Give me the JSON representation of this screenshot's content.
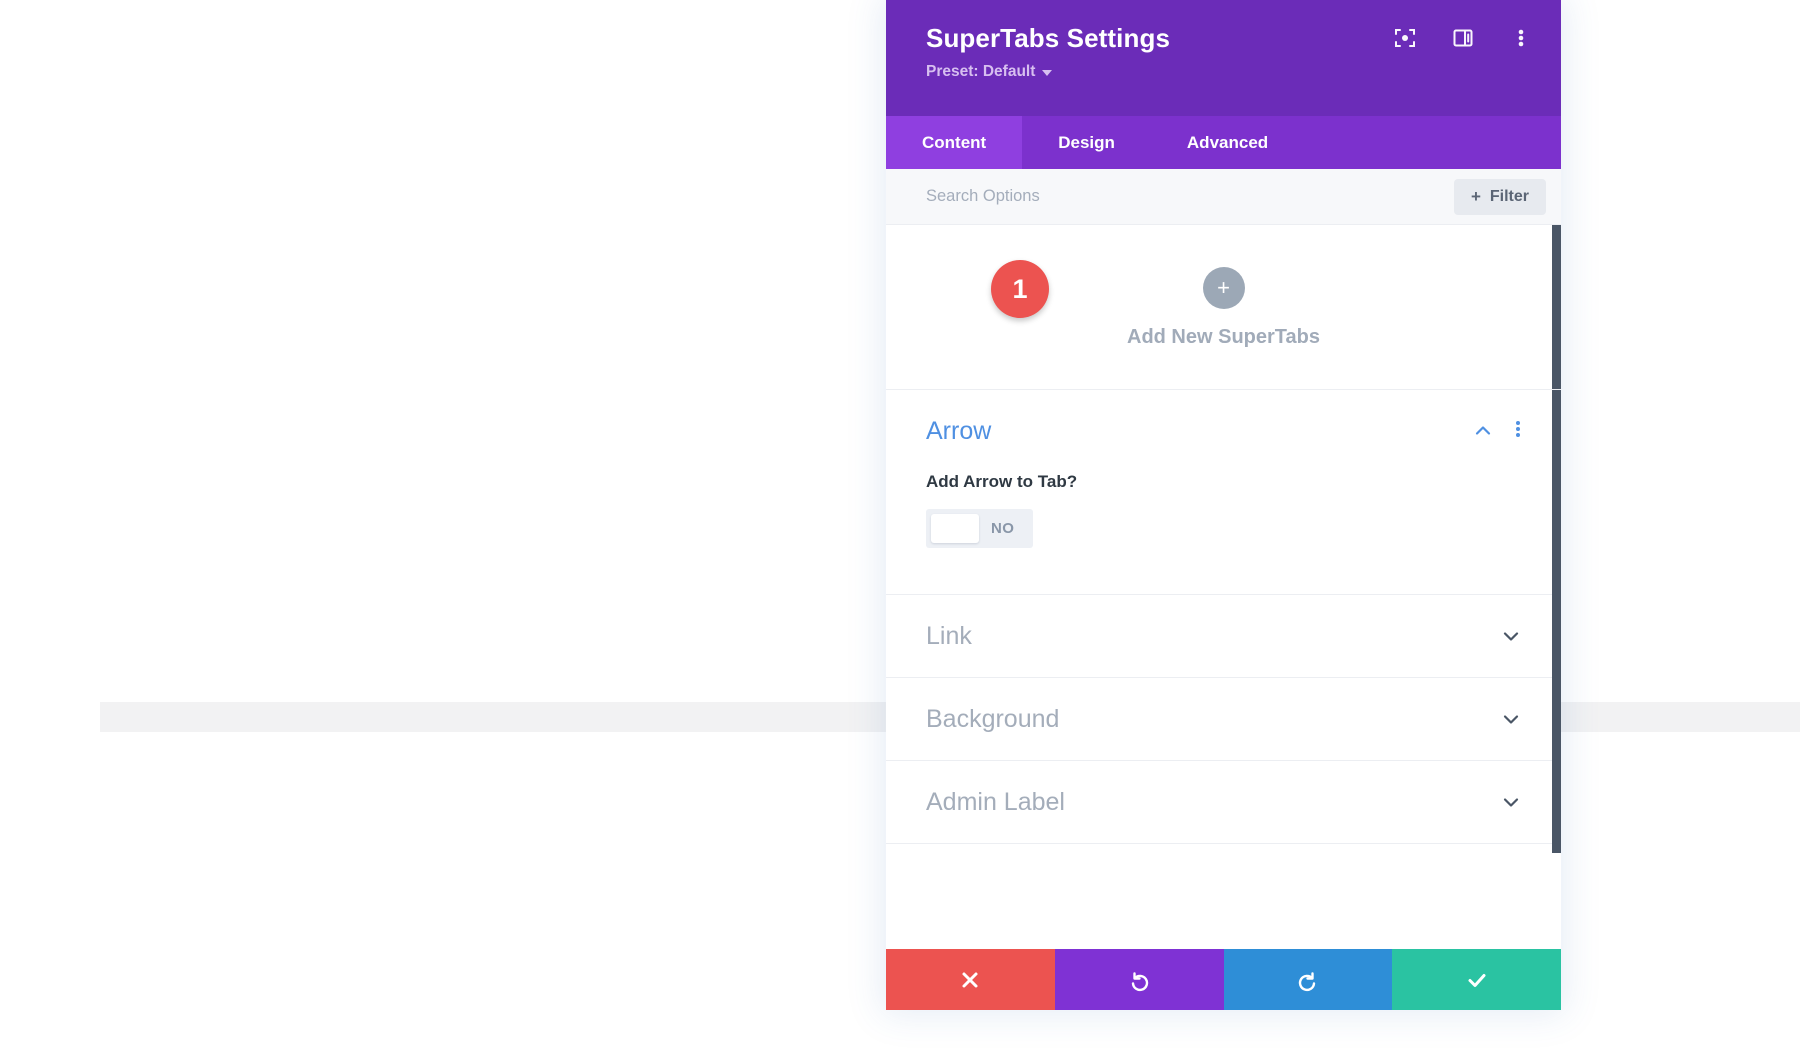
{
  "modal": {
    "title": "SuperTabs Settings",
    "preset_label": "Preset: Default",
    "header_icons": [
      {
        "name": "focus-target-icon",
        "glyph": "focus"
      },
      {
        "name": "layout-panel-icon",
        "glyph": "layout"
      },
      {
        "name": "overflow-menu-icon",
        "glyph": "dots"
      }
    ],
    "tabs": [
      {
        "label": "Content",
        "active": true
      },
      {
        "label": "Design",
        "active": false
      },
      {
        "label": "Advanced",
        "active": false
      }
    ],
    "search": {
      "placeholder": "Search Options",
      "value": "",
      "filter_label": "Filter",
      "filter_plus": "+"
    },
    "add_new": {
      "plus_glyph": "+",
      "label": "Add New SuperTabs",
      "step_badge": "1"
    },
    "groups": [
      {
        "title": "Arrow",
        "state": "open",
        "field_label": "Add Arrow to Tab?",
        "toggle_value": "NO"
      },
      {
        "title": "Link",
        "state": "closed"
      },
      {
        "title": "Background",
        "state": "closed"
      },
      {
        "title": "Admin Label",
        "state": "closed"
      }
    ],
    "footer_buttons": [
      {
        "name": "discard-button",
        "glyph": "✖"
      },
      {
        "name": "undo-button",
        "glyph": "↺"
      },
      {
        "name": "redo-button",
        "glyph": "↻"
      },
      {
        "name": "save-button",
        "glyph": "✔"
      }
    ]
  },
  "colors": {
    "header_purple": "#6b2cb8",
    "tabbar_purple": "#7c31cd",
    "tab_active_purple": "#8f3fe0",
    "group_open_blue": "#4f90e2",
    "group_closed_gray": "#a4adba",
    "badge_red": "#ec5350",
    "discard_red": "#ec5350",
    "undo_purple": "#7f32d4",
    "redo_blue": "#2e8ed7",
    "save_green": "#2ac3a2"
  }
}
